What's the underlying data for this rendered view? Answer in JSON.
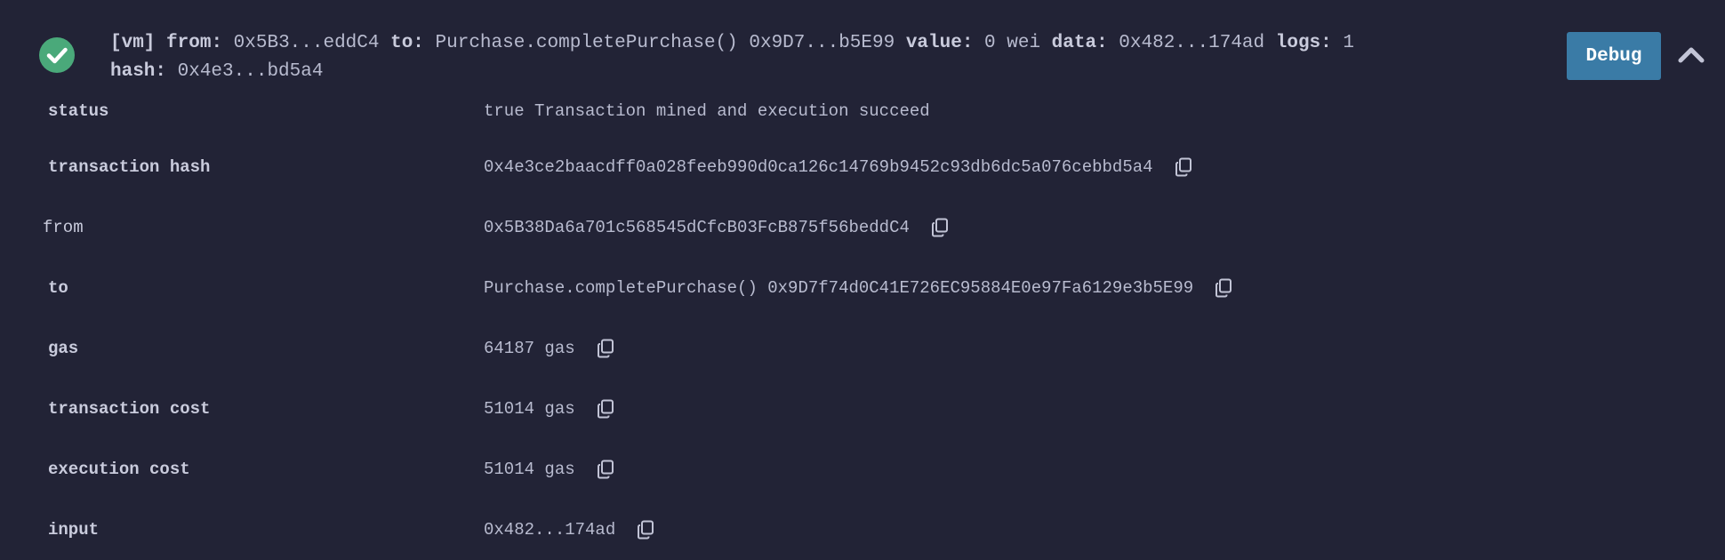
{
  "transaction": {
    "summary": {
      "env": "[vm]",
      "from_key": "from:",
      "from_val": "0x5B3...eddC4",
      "to_key": "to:",
      "to_val": "Purchase.completePurchase() 0x9D7...b5E99",
      "value_key": "value:",
      "value_val": "0 wei",
      "data_key": "data:",
      "data_val": "0x482...174ad",
      "logs_key": "logs:",
      "logs_val": "1",
      "hash_key": "hash:",
      "hash_val": "0x4e3...bd5a4"
    },
    "status_icon": "check-circle-icon",
    "debug_label": "Debug",
    "collapse_icon": "chevron-up-icon",
    "colors": {
      "background": "#222336",
      "success": "#4aa97a",
      "debug_button": "#3a7ba6"
    },
    "details": [
      {
        "label": "status",
        "value": "true Transaction mined and execution succeed",
        "copy": false,
        "bold": true
      },
      {
        "label": "transaction hash",
        "value": "0x4e3ce2baacdff0a028feeb990d0ca126c14769b9452c93db6dc5a076cebbd5a4",
        "copy": true,
        "bold": true
      },
      {
        "label": "from",
        "value": "0x5B38Da6a701c568545dCfcB03FcB875f56beddC4",
        "copy": true,
        "bold": false
      },
      {
        "label": "to",
        "value": "Purchase.completePurchase() 0x9D7f74d0C41E726EC95884E0e97Fa6129e3b5E99",
        "copy": true,
        "bold": true
      },
      {
        "label": "gas",
        "value": "64187 gas",
        "copy": true,
        "bold": true
      },
      {
        "label": "transaction cost",
        "value": "51014 gas",
        "copy": true,
        "bold": true
      },
      {
        "label": "execution cost",
        "value": "51014 gas",
        "copy": true,
        "bold": true
      },
      {
        "label": "input",
        "value": "0x482...174ad",
        "copy": true,
        "bold": true
      }
    ]
  }
}
